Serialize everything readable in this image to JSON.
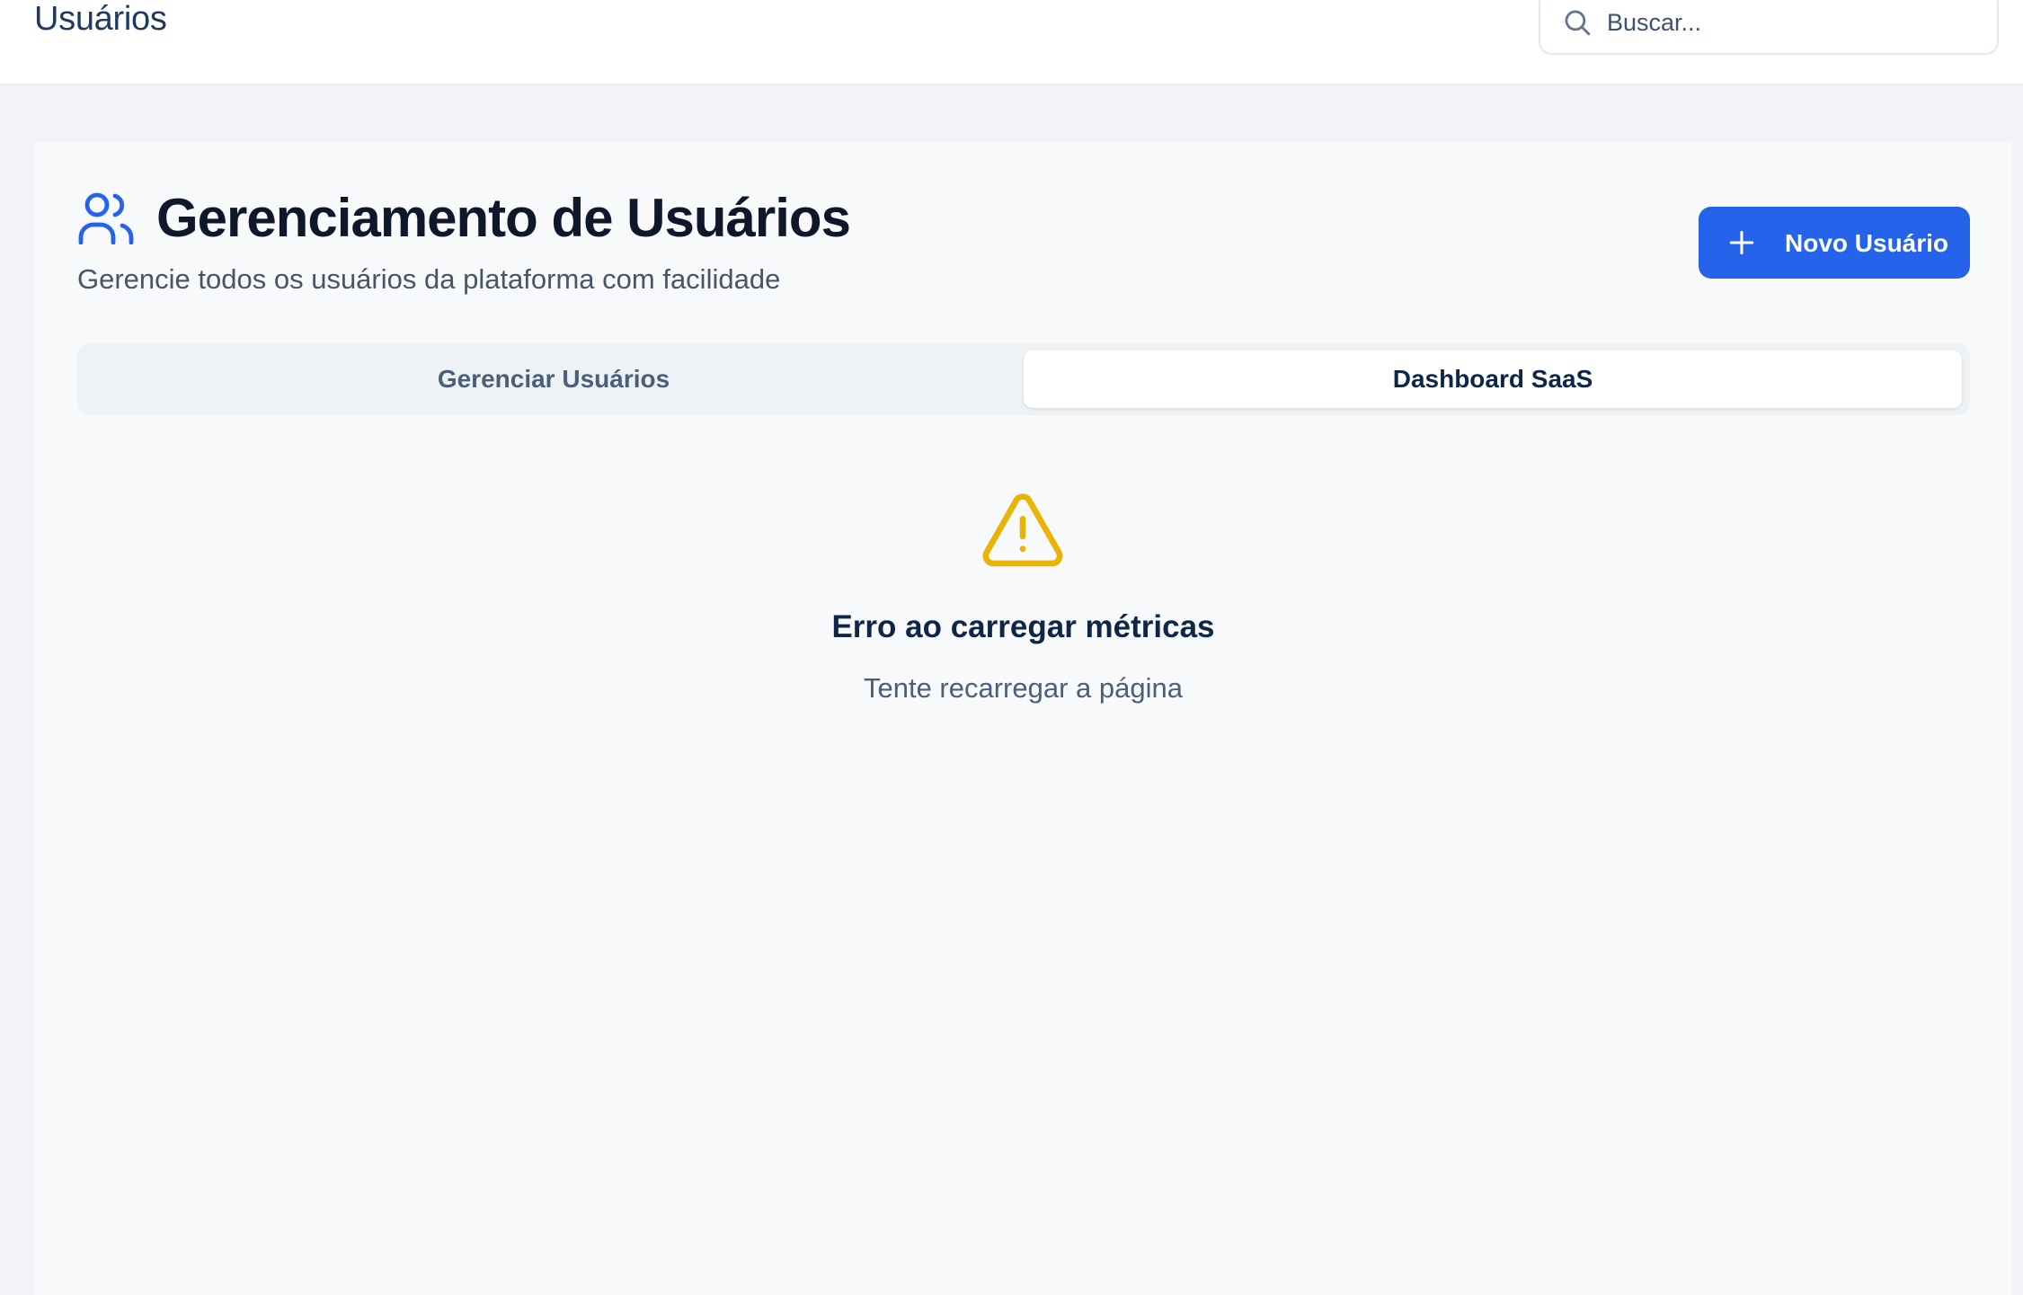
{
  "header": {
    "breadcrumb": "Usuários",
    "search_placeholder": "Buscar..."
  },
  "page": {
    "title": "Gerenciamento de Usuários",
    "subtitle": "Gerencie todos os usuários da plataforma com facilidade",
    "new_user_button": "Novo Usuário"
  },
  "tabs": [
    {
      "label": "Gerenciar Usuários",
      "active": false
    },
    {
      "label": "Dashboard SaaS",
      "active": true
    }
  ],
  "error": {
    "title": "Erro ao carregar métricas",
    "hint": "Tente recarregar a página"
  },
  "colors": {
    "accent": "#2563eb",
    "warning": "#eab308",
    "title": "#0f172a"
  },
  "icons": {
    "search": "search-icon",
    "users": "users-icon",
    "plus": "plus-icon",
    "warning": "warning-icon"
  }
}
